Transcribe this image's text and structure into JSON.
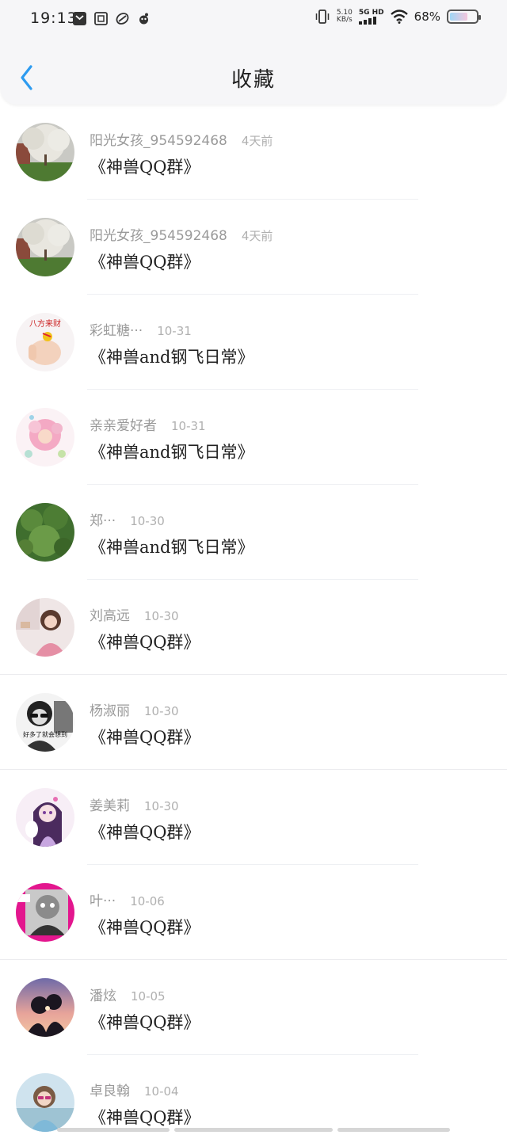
{
  "status": {
    "time": "19:13",
    "speed_top": "5.10",
    "speed_unit": "KB/s",
    "network": "5G HD",
    "battery_text": "68%",
    "battery_level": 0.68
  },
  "nav": {
    "title": "收藏",
    "back_icon": "chevron-left-icon"
  },
  "favorites": [
    {
      "name": "阳光女孩_954592468",
      "time": "4天前",
      "group": "《神兽QQ群》"
    },
    {
      "name": "阳光女孩_954592468",
      "time": "4天前",
      "group": "《神兽QQ群》"
    },
    {
      "name": "彩虹糖···",
      "time": "10-31",
      "group": "《神兽and钢飞日常》"
    },
    {
      "name": "亲亲爱好者",
      "time": "10-31",
      "group": "《神兽and钢飞日常》"
    },
    {
      "name": "郑···",
      "time": "10-30",
      "group": "《神兽and钢飞日常》"
    },
    {
      "name": "刘高远",
      "time": "10-30",
      "group": "《神兽QQ群》"
    },
    {
      "name": "杨淑丽",
      "time": "10-30",
      "group": "《神兽QQ群》"
    },
    {
      "name": "姜美莉",
      "time": "10-30",
      "group": "《神兽QQ群》"
    },
    {
      "name": "叶···",
      "time": "10-06",
      "group": "《神兽QQ群》"
    },
    {
      "name": "潘炫",
      "time": "10-05",
      "group": "《神兽QQ群》"
    },
    {
      "name": "卓良翰",
      "time": "10-04",
      "group": "《神兽QQ群》"
    }
  ],
  "avatar_texts": {
    "caihongtang": "八方来财",
    "yangshuli": "好多了就会想到"
  },
  "colors": {
    "accent": "#2d9bf0",
    "background": "#ffffff",
    "nav_bg": "#f6f6f8"
  }
}
